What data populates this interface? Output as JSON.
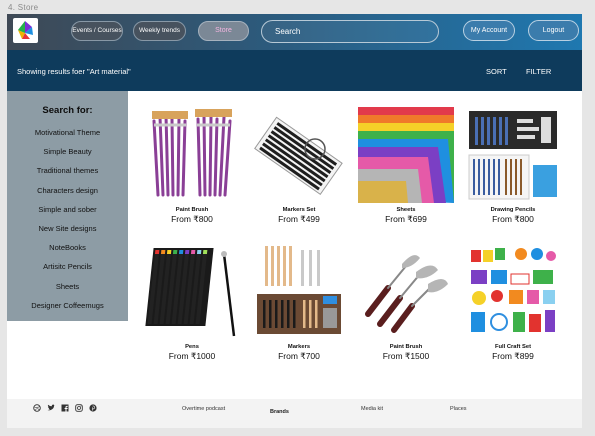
{
  "frame_label": "4. Store",
  "header": {
    "nav": [
      {
        "label": "Events / Courses"
      },
      {
        "label": "Weekly trends"
      },
      {
        "label": "Store"
      }
    ],
    "search_label": "Search",
    "account_label": "My Account",
    "logout_label": "Logout"
  },
  "results": {
    "text": "Showing results foer \"Art material\"",
    "sort_label": "SORT",
    "filter_label": "FILTER"
  },
  "sidebar": {
    "title": "Search for:",
    "items": [
      {
        "label": "Motivational Theme"
      },
      {
        "label": "Simple Beauty"
      },
      {
        "label": "Traditional themes"
      },
      {
        "label": "Characters design"
      },
      {
        "label": "Simple and sober"
      },
      {
        "label": "New Site designs"
      },
      {
        "label": "NoteBooks"
      },
      {
        "label": "Artisitc Pencils"
      },
      {
        "label": "Sheets"
      },
      {
        "label": "Designer Coffeemugs"
      }
    ]
  },
  "products": [
    {
      "name": "Paint Brush",
      "price": "From ₹800",
      "image_icon": "paint-brushes-image"
    },
    {
      "name": "Markers Set",
      "price": "From ₹499",
      "image_icon": "markers-set-image"
    },
    {
      "name": "Sheets",
      "price": "From ₹699",
      "image_icon": "glitter-sheets-image"
    },
    {
      "name": "Drawing Pencils",
      "price": "From ₹800",
      "image_icon": "drawing-pencils-kit-image"
    },
    {
      "name": "Pens",
      "price": "From ₹1000",
      "image_icon": "colored-pens-image"
    },
    {
      "name": "Markers",
      "price": "From ₹700",
      "image_icon": "sketch-markers-roll-image"
    },
    {
      "name": "Paint Brush",
      "price": "From ₹1500",
      "image_icon": "palette-knives-image"
    },
    {
      "name": "Full Craft Set",
      "price": "From ₹899",
      "image_icon": "craft-set-image"
    }
  ],
  "footer": {
    "social_icons": [
      "dribbble-icon",
      "twitter-icon",
      "facebook-icon",
      "instagram-icon",
      "pinterest-icon"
    ],
    "links": [
      {
        "label": "Overtime podcast"
      },
      {
        "label": "Brands"
      },
      {
        "label": "Media kit"
      },
      {
        "label": "Places"
      }
    ]
  },
  "colors": {
    "header_start": "#3f4955",
    "header_end": "#1f78b0",
    "results_bar": "#0e3b5c",
    "sidebar": "#8d9ca5",
    "active_nav_text": "#f3b5e0"
  }
}
